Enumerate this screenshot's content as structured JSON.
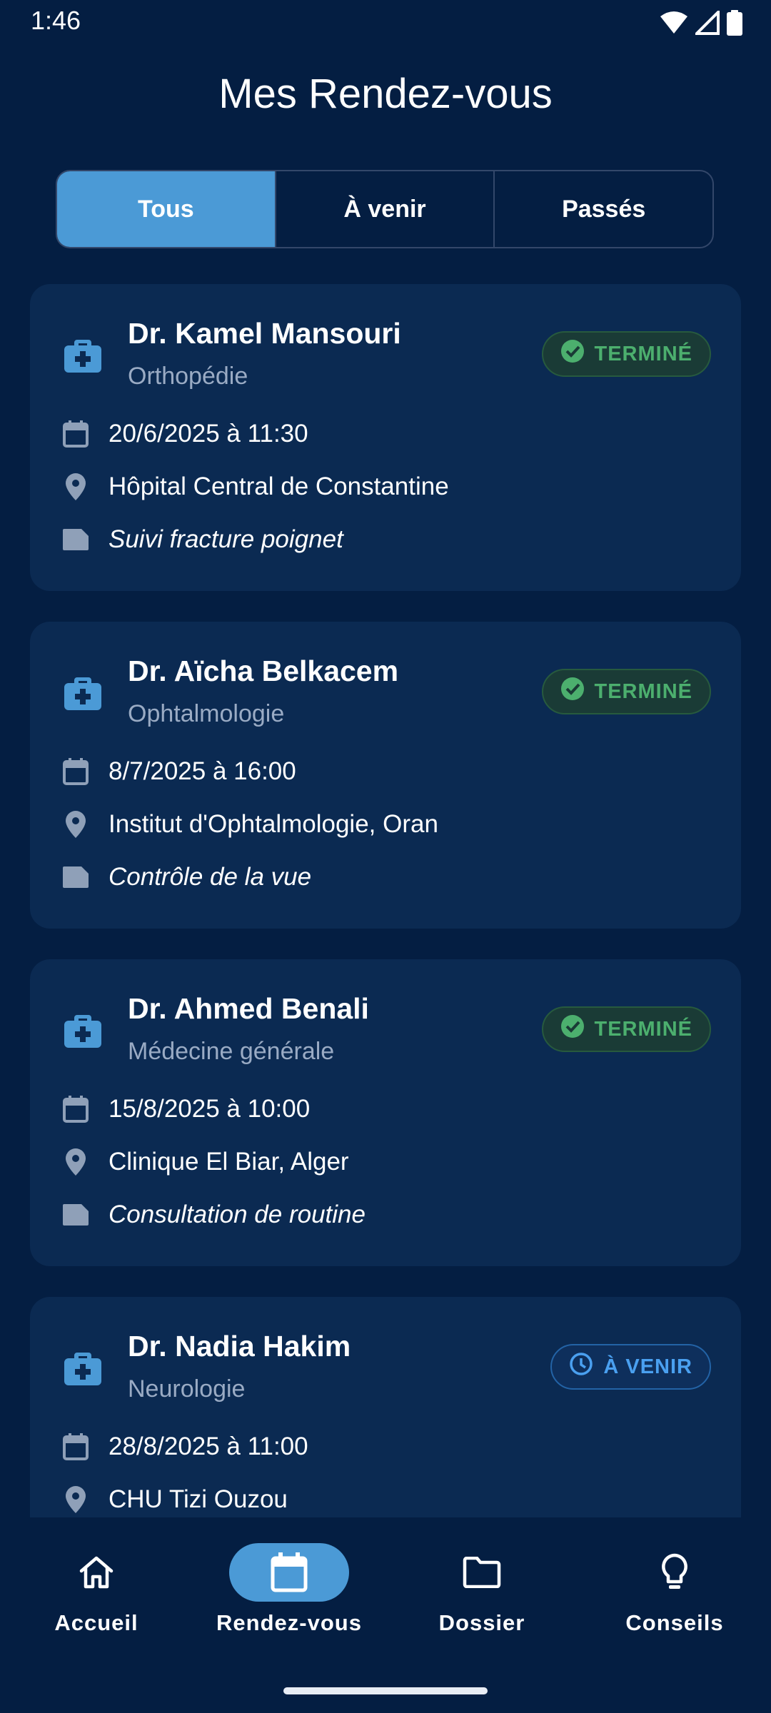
{
  "status_bar": {
    "time": "1:46",
    "icons": [
      "wifi-icon",
      "signal-icon",
      "battery-icon"
    ]
  },
  "header": {
    "title": "Mes Rendez-vous"
  },
  "tabs": [
    {
      "label": "Tous",
      "active": true
    },
    {
      "label": "À venir",
      "active": false
    },
    {
      "label": "Passés",
      "active": false
    }
  ],
  "appointments": [
    {
      "doctor": "Dr. Kamel Mansouri",
      "specialty": "Orthopédie",
      "status": "TERMINÉ",
      "datetime": "20/6/2025 à 11:30",
      "place": "Hôpital Central de Constantine",
      "note": "Suivi fracture poignet"
    },
    {
      "doctor": "Dr. Aïcha Belkacem",
      "specialty": "Ophtalmologie",
      "status": "TERMINÉ",
      "datetime": "8/7/2025 à 16:00",
      "place": "Institut d'Ophtalmologie, Oran",
      "note": "Contrôle de la vue"
    },
    {
      "doctor": "Dr. Ahmed Benali",
      "specialty": "Médecine générale",
      "status": "TERMINÉ",
      "datetime": "15/8/2025 à 10:00",
      "place": "Clinique El Biar, Alger",
      "note": "Consultation de routine"
    },
    {
      "doctor": "Dr. Nadia Hakim",
      "specialty": "Neurologie",
      "status": "À VENIR",
      "datetime": "28/8/2025 à 11:00",
      "place": "CHU Tizi Ouzou",
      "note": ""
    }
  ],
  "bottom_nav": [
    {
      "label": "Accueil",
      "icon": "home-icon",
      "active": false
    },
    {
      "label": "Rendez-vous",
      "icon": "calendar-icon",
      "active": true
    },
    {
      "label": "Dossier",
      "icon": "folder-icon",
      "active": false
    },
    {
      "label": "Conseils",
      "icon": "lightbulb-icon",
      "active": false
    }
  ],
  "colors": {
    "background": "#041e42",
    "card": "#0b2a52",
    "accent": "#4b9ad6",
    "done": "#4caf6e",
    "upcoming": "#4aa0f0"
  }
}
